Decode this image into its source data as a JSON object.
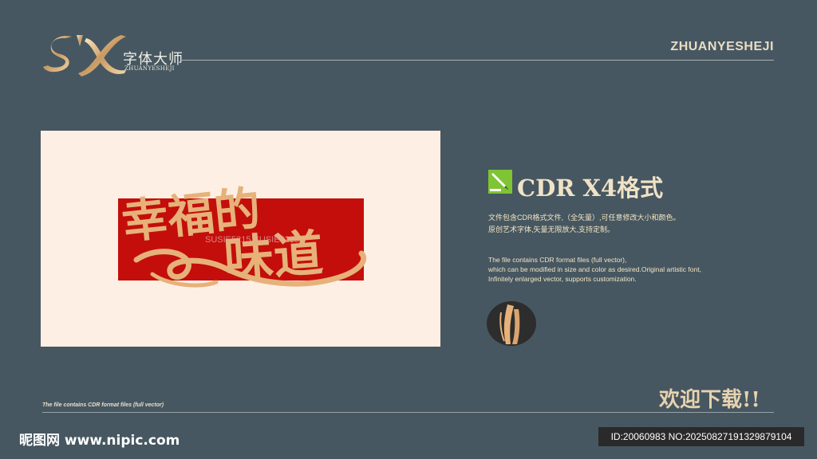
{
  "header": {
    "brand_mark": "S'X",
    "brand_name_cn": "字体大师",
    "brand_name_en": "ZHUANYESHEJI",
    "right_text": "ZHUANYESHEJI"
  },
  "preview": {
    "artwork_text_line1": "幸福的",
    "artwork_text_line2": "味道",
    "watermark": "SUSIE5215 SUSIE5215"
  },
  "info": {
    "icon": "corel-draw-icon",
    "title": "CDR X4格式",
    "desc_cn_line1": "文件包含CDR格式文件,（全矢量）,可任意修改大小和颜色。",
    "desc_cn_line2": "原创艺术字体,矢量无限放大,支持定制。",
    "desc_en_line1": "The file contains CDR format files (full vector),",
    "desc_en_line2": " which can be modified in size and color as desired.Original artistic font,",
    "desc_en_line3": "Infinitely enlarged vector, supports customization."
  },
  "footer": {
    "welcome": "欢迎下载!!",
    "small_text": "The file contains CDR format files (full vector)",
    "site_logo": "昵图网 www.nipic.com",
    "id_text": "ID:20060983 NO:20250827191329879104"
  },
  "colors": {
    "background": "#465761",
    "panel": "#fdefe4",
    "banner_red": "#c40e0b",
    "gold": "#e6b27a"
  }
}
